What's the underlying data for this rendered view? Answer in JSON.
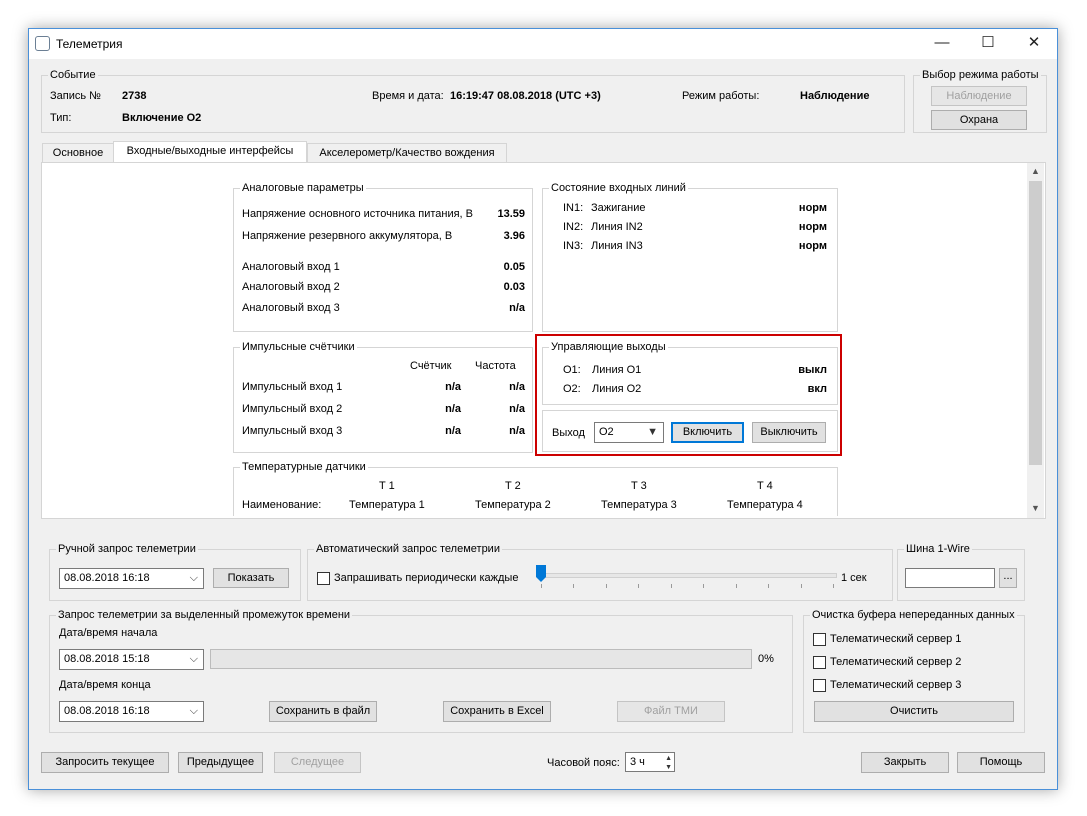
{
  "window": {
    "title": "Телеметрия",
    "minimize": "—",
    "maximize": "☐",
    "close": "✕"
  },
  "event": {
    "legend": "Событие",
    "record_label": "Запись №",
    "record_value": "2738",
    "type_label": "Тип:",
    "type_value": "Включение О2",
    "datetime_label": "Время и дата:",
    "datetime_value": "16:19:47 08.08.2018 (UTC +3)",
    "mode_label": "Режим работы:",
    "mode_value": "Наблюдение"
  },
  "mode_select": {
    "legend": "Выбор режима работы",
    "observe": "Наблюдение",
    "guard": "Охрана"
  },
  "tabs": [
    "Основное",
    "Входные/выходные интерфейсы",
    "Акселерометр/Качество вождения"
  ],
  "analog": {
    "legend": "Аналоговые параметры",
    "rows": [
      {
        "label": "Напряжение основного источника питания, В",
        "value": "13.59"
      },
      {
        "label": "Напряжение резервного аккумулятора, В",
        "value": "3.96"
      },
      {
        "label": "Аналоговый вход 1",
        "value": "0.05"
      },
      {
        "label": "Аналоговый вход 2",
        "value": "0.03"
      },
      {
        "label": "Аналоговый вход 3",
        "value": "n/a"
      }
    ]
  },
  "input_lines": {
    "legend": "Состояние входных линий",
    "rows": [
      {
        "id": "IN1:",
        "name": "Зажигание",
        "state": "норм"
      },
      {
        "id": "IN2:",
        "name": "Линия IN2",
        "state": "норм"
      },
      {
        "id": "IN3:",
        "name": "Линия IN3",
        "state": "норм"
      }
    ]
  },
  "pulse": {
    "legend": "Импульсные счётчики",
    "col_counter": "Счётчик",
    "col_freq": "Частота",
    "rows": [
      {
        "label": "Импульсный вход 1",
        "counter": "n/a",
        "freq": "n/a"
      },
      {
        "label": "Импульсный вход 2",
        "counter": "n/a",
        "freq": "n/a"
      },
      {
        "label": "Импульсный вход 3",
        "counter": "n/a",
        "freq": "n/a"
      }
    ]
  },
  "outputs": {
    "legend": "Управляющие выходы",
    "rows": [
      {
        "id": "O1:",
        "name": "Линия O1",
        "state": "выкл"
      },
      {
        "id": "O2:",
        "name": "Линия O2",
        "state": "вкл"
      }
    ],
    "output_label": "Выход",
    "output_selected": "O2",
    "on_button": "Включить",
    "off_button": "Выключить",
    "highlight_color": "#cc0000"
  },
  "temp": {
    "legend": "Температурные датчики",
    "name_label": "Наименование:",
    "sensors": [
      {
        "id": "T 1",
        "name": "Температура 1"
      },
      {
        "id": "T 2",
        "name": "Температура 2"
      },
      {
        "id": "T 3",
        "name": "Температура 3"
      },
      {
        "id": "T 4",
        "name": "Температура 4"
      }
    ]
  },
  "manual": {
    "legend": "Ручной запрос телеметрии",
    "date": "08.08.2018 16:18",
    "show_button": "Показать"
  },
  "auto": {
    "legend": "Автоматический запрос телеметрии",
    "checkbox_label": "Запрашивать периодически каждые",
    "interval": "1 сек",
    "slider_fraction": 0
  },
  "onewire": {
    "legend": "Шина 1-Wire",
    "value": "",
    "browse": "..."
  },
  "range": {
    "legend": "Запрос телеметрии за выделенный промежуток времени",
    "start_label": "Дата/время начала",
    "start_value": "08.08.2018 15:18",
    "progress": "0%",
    "end_label": "Дата/время конца",
    "end_value": "08.08.2018 16:18",
    "save_file": "Сохранить в файл",
    "save_excel": "Сохранить в Excel",
    "tmi_file": "Файл ТМИ"
  },
  "buffer": {
    "legend": "Очистка буфера непереданных данных",
    "servers": [
      "Телематический сервер 1",
      "Телематический сервер 2",
      "Телематический сервер 3"
    ],
    "clear": "Очистить"
  },
  "footer": {
    "request_current": "Запросить текущее",
    "previous": "Предыдущее",
    "next": "Следущее",
    "tz_label": "Часовой пояс:",
    "tz_value": "3 ч",
    "close": "Закрыть",
    "help": "Помощь"
  }
}
